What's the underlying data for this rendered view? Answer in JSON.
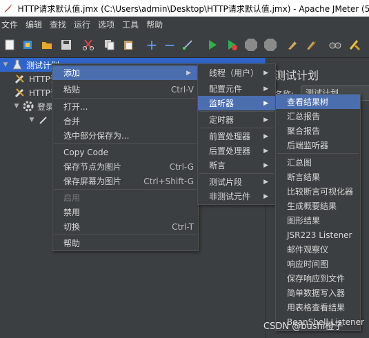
{
  "window": {
    "title": "HTTP请求默认值.jmx (C:\\Users\\admin\\Desktop\\HTTP请求默认值.jmx) - Apache JMeter (5.6"
  },
  "menubar": [
    "文件",
    "编辑",
    "查找",
    "运行",
    "选项",
    "工具",
    "帮助"
  ],
  "toolbar": {
    "icons": [
      "new-icon",
      "templates-icon",
      "open-icon",
      "save-icon",
      "cut-icon",
      "copy-icon",
      "paste-icon",
      "expand-icon",
      "collapse-icon",
      "toggle-icon",
      "start-icon",
      "start-no-pause-icon",
      "stop-icon",
      "shutdown-icon",
      "clear-icon",
      "clear-all-icon",
      "search-icon",
      "reset-search-icon"
    ]
  },
  "tree": {
    "root": "测试计划",
    "items": [
      "HTTP请求默认值",
      "HTTP请求",
      "登录"
    ]
  },
  "right_pane": {
    "title": "测试计划",
    "name_label": "名称:",
    "name_value": "测试计划"
  },
  "context_menu": {
    "items": [
      {
        "label": "添加",
        "shortcut": "",
        "submenu": true,
        "highlighted": true
      },
      {
        "label": "粘贴",
        "shortcut": "Ctrl-V"
      },
      {
        "label": "打开..."
      },
      {
        "label": "合并"
      },
      {
        "label": "选中部分保存为..."
      },
      {
        "label": "Copy Code"
      },
      {
        "label": "保存节点为图片",
        "shortcut": "Ctrl-G"
      },
      {
        "label": "保存屏幕为图片",
        "shortcut": "Ctrl+Shift-G"
      },
      {
        "label": "启用",
        "disabled": true
      },
      {
        "label": "禁用"
      },
      {
        "label": "切换",
        "shortcut": "Ctrl-T"
      },
      {
        "label": "帮助"
      }
    ]
  },
  "add_submenu": {
    "items": [
      "线程（用户）",
      "配置元件",
      "监听器",
      "定时器",
      "前置处理器",
      "后置处理器",
      "断言",
      "测试片段",
      "非测试元件"
    ],
    "highlighted": "监听器"
  },
  "listener_submenu": {
    "items": [
      "查看结果树",
      "汇总报告",
      "聚合报告",
      "后端监听器",
      "汇总图",
      "断言结果",
      "比较断言可视化器",
      "生成概要结果",
      "图形结果",
      "JSR223 Listener",
      "邮件观察仪",
      "响应时间图",
      "保存响应到文件",
      "简单数据写入器",
      "用表格查看结果",
      "BeanShell Listener"
    ],
    "highlighted": "查看结果树"
  },
  "watermark": "CSDN @bushi橙子",
  "colors": {
    "background": "#3c3f41",
    "highlight": "#4b6eaf",
    "tree_selection": "#2f65ca"
  }
}
